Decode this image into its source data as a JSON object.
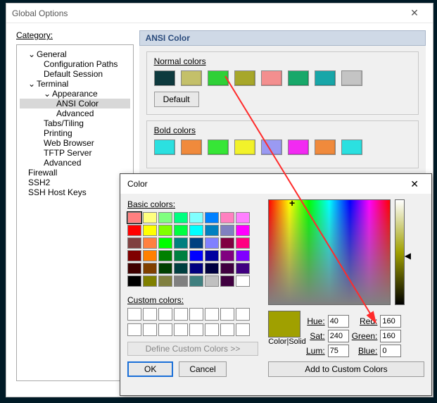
{
  "window": {
    "title": "Global Options"
  },
  "category": {
    "label": "Category:",
    "tree": [
      {
        "label": "General",
        "depth": 1,
        "exp": "⌄"
      },
      {
        "label": "Configuration Paths",
        "depth": 2
      },
      {
        "label": "Default Session",
        "depth": 2
      },
      {
        "label": "Terminal",
        "depth": 1,
        "exp": "⌄"
      },
      {
        "label": "Appearance",
        "depth": 2,
        "exp": "⌄"
      },
      {
        "label": "ANSI Color",
        "depth": 3,
        "selected": true
      },
      {
        "label": "Advanced",
        "depth": 3
      },
      {
        "label": "Tabs/Tiling",
        "depth": 2
      },
      {
        "label": "Printing",
        "depth": 2
      },
      {
        "label": "Web Browser",
        "depth": 2
      },
      {
        "label": "TFTP Server",
        "depth": 2
      },
      {
        "label": "Advanced",
        "depth": 2
      },
      {
        "label": "Firewall",
        "depth": 1
      },
      {
        "label": "SSH2",
        "depth": 1
      },
      {
        "label": "SSH Host Keys",
        "depth": 1
      }
    ]
  },
  "ansi": {
    "title": "ANSI Color",
    "normal": {
      "label": "Normal colors",
      "default_label": "Default",
      "colors": [
        "#0e3a3e",
        "#c4c06a",
        "#2fd037",
        "#a7a72a",
        "#f38f8f",
        "#18a86a",
        "#18a6a8",
        "#c4c4c4"
      ]
    },
    "bold": {
      "label": "Bold colors",
      "colors": [
        "#2be0e0",
        "#f08a3c",
        "#36e636",
        "#f2f22a",
        "#9a9af2",
        "#f22af2",
        "#f08a3c",
        "#2be0e0"
      ]
    }
  },
  "color_dialog": {
    "title": "Color",
    "basic_label": "Basic colors:",
    "custom_label": "Custom colors:",
    "selected_basic": 0,
    "basic_grid": [
      "#ff8080",
      "#ffff80",
      "#80ff80",
      "#00ff80",
      "#80ffff",
      "#0080ff",
      "#ff80c0",
      "#ff80ff",
      "#ff0000",
      "#ffff00",
      "#80ff00",
      "#00ff40",
      "#00ffff",
      "#0080c0",
      "#8080c0",
      "#ff00ff",
      "#804040",
      "#ff8040",
      "#00ff00",
      "#008080",
      "#004080",
      "#8080ff",
      "#800040",
      "#ff0080",
      "#800000",
      "#ff8000",
      "#008000",
      "#008040",
      "#0000ff",
      "#0000a0",
      "#800080",
      "#8000ff",
      "#400000",
      "#804000",
      "#004000",
      "#004040",
      "#000080",
      "#000040",
      "#400040",
      "#400080",
      "#000000",
      "#808000",
      "#808040",
      "#808080",
      "#408080",
      "#c0c0c0",
      "#400040",
      "#ffffff"
    ],
    "define_label": "Define Custom Colors >>",
    "ok_label": "OK",
    "cancel_label": "Cancel",
    "colorsolid_label": "Color|Solid",
    "hsl": {
      "hue_label": "Hue:",
      "sat_label": "Sat:",
      "lum_label": "Lum:"
    },
    "rgb": {
      "red_label": "Red:",
      "green_label": "Green:",
      "blue_label": "Blue:"
    },
    "values": {
      "hue": "40",
      "sat": "240",
      "lum": "75",
      "red": "160",
      "green": "160",
      "blue": "0"
    },
    "preview_color": "#a0a000",
    "add_label": "Add to Custom Colors"
  }
}
